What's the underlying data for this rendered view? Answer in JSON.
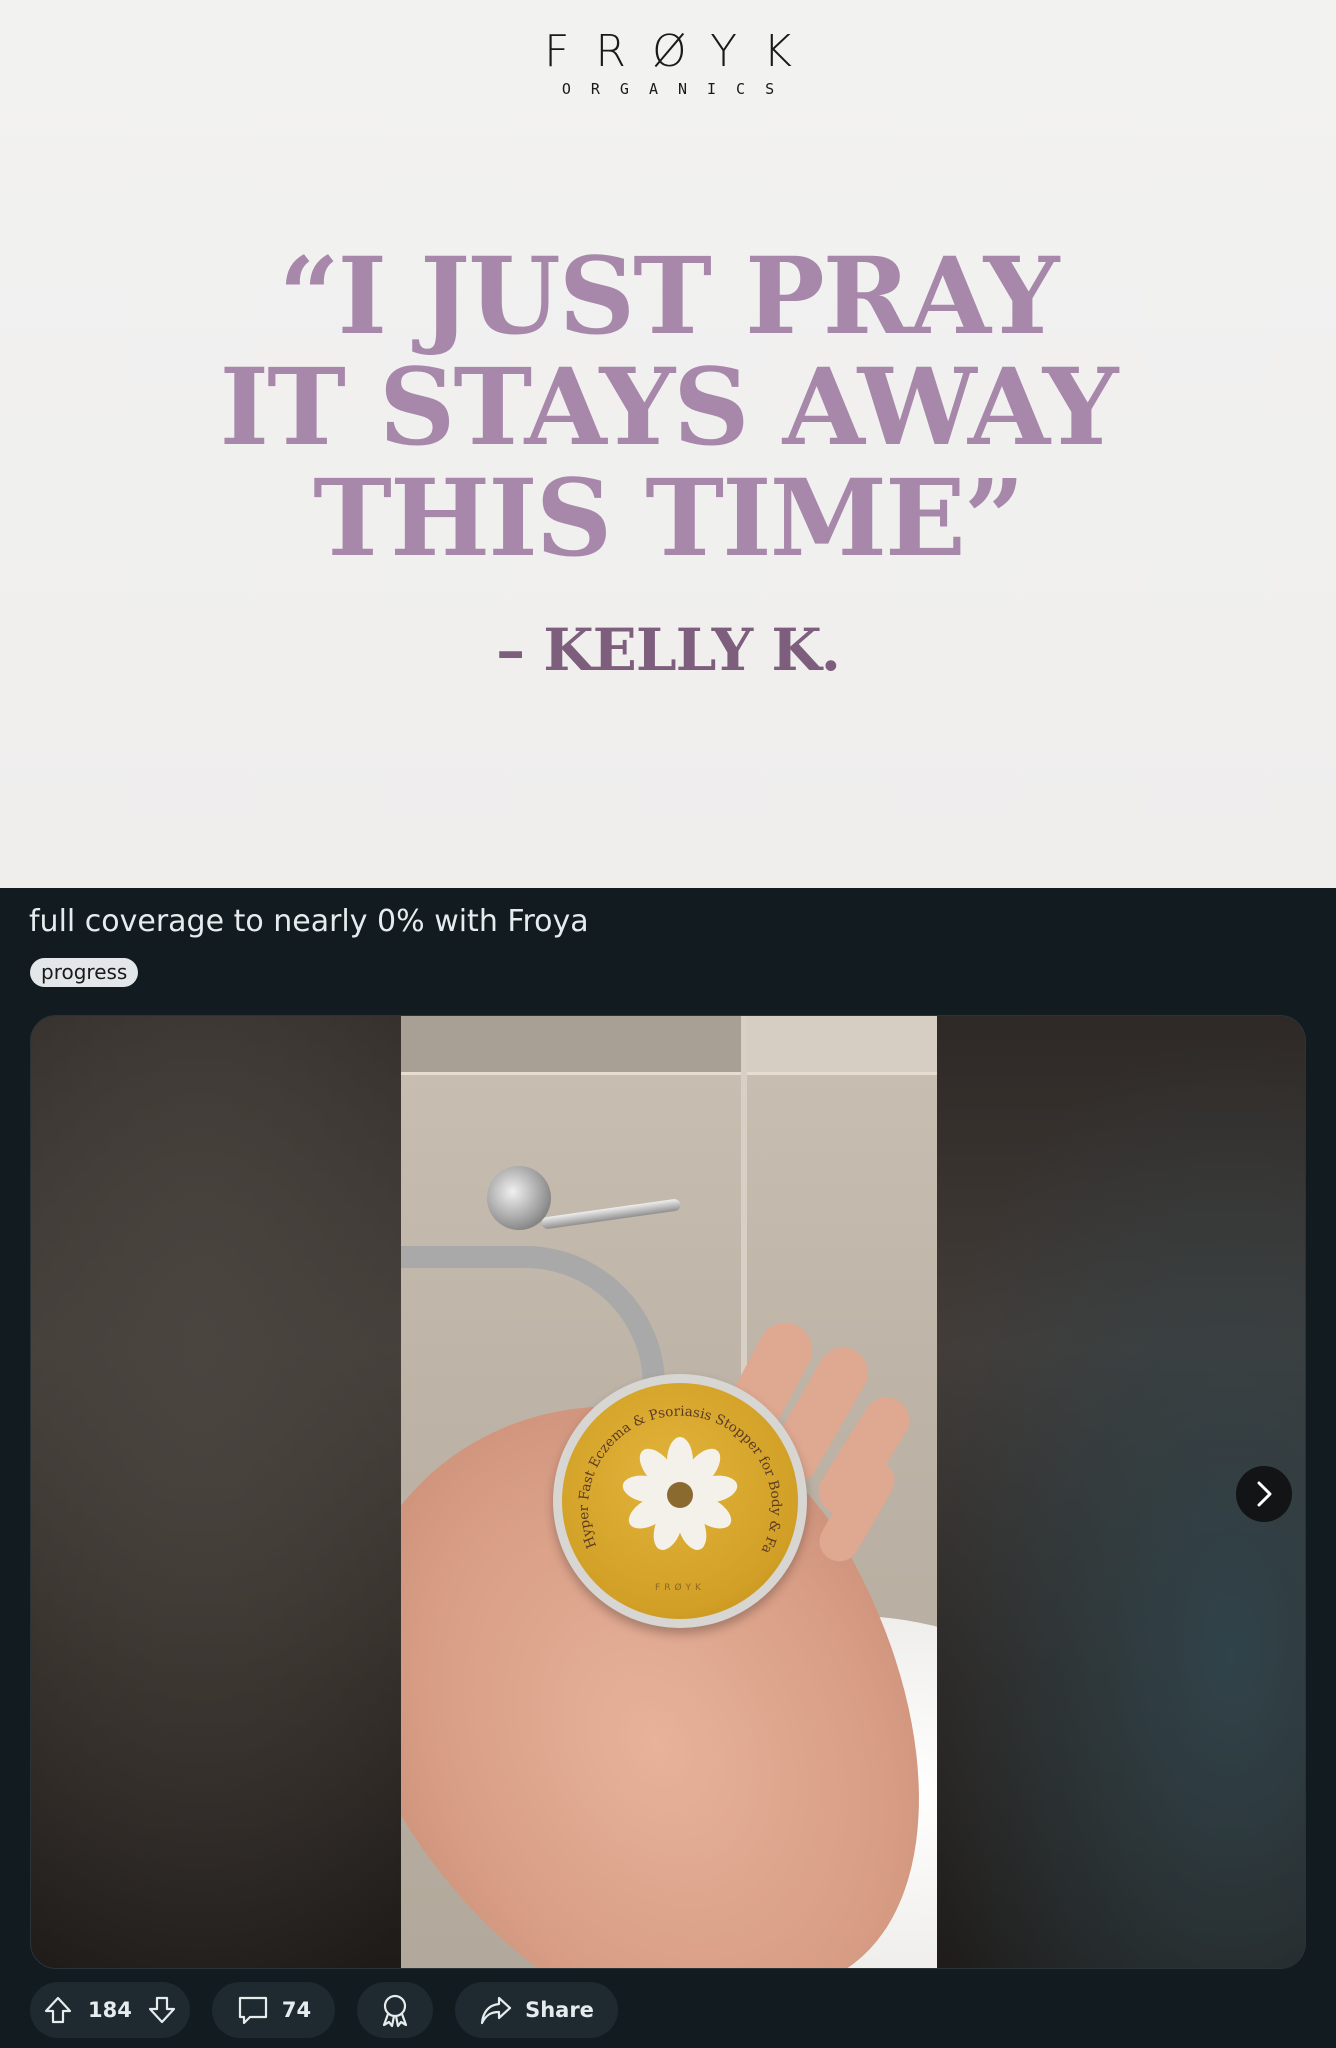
{
  "ad": {
    "brand_name": "FRØYK",
    "brand_sub": "ORGANICS",
    "quote_lines": [
      "“I JUST PRAY",
      "IT STAYS AWAY",
      "THIS TIME”"
    ],
    "author": "– KELLY K."
  },
  "post": {
    "title": "full coverage to nearly 0% with Froya",
    "flair": "progress",
    "media": {
      "jar_ring_text": "Hyper Fast Eczema & Psoriasis Stopper for Body & Face",
      "jar_brand": "FRØYK",
      "next_icon": "chevron-right-icon"
    },
    "actions": {
      "upvote_icon": "arrow-up-icon",
      "score": "184",
      "downvote_icon": "arrow-down-icon",
      "comment_icon": "speech-bubble-icon",
      "comments": "74",
      "award_icon": "award-ribbon-icon",
      "share_icon": "share-arrow-icon",
      "share_label": "Share"
    }
  },
  "colors": {
    "quote": "#a888aa",
    "author": "#7d5f7d",
    "post_bg": "#121c20",
    "pill_bg": "#1e2a2f",
    "flair_bg": "#e4e7e9"
  }
}
